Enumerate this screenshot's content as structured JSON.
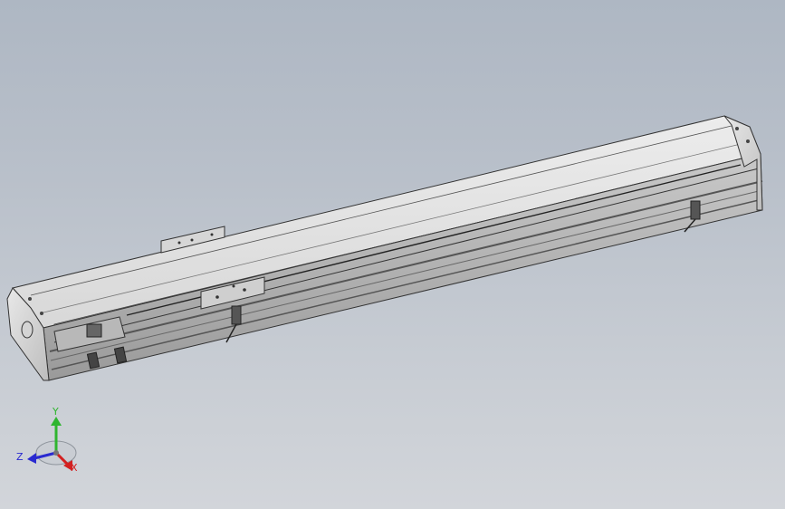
{
  "viewport": {
    "background_top": "#aeb7c3",
    "background_bottom": "#d2d5da"
  },
  "model": {
    "part": "linear-actuator-module",
    "body_color": "#e3e3e3",
    "edge_color": "#333333",
    "slot_color": "#555555"
  },
  "triad": {
    "x_label": "X",
    "y_label": "Y",
    "z_label": "Z",
    "x_color": "#d32020",
    "y_color": "#2fb52f",
    "z_color": "#2a2ad0"
  }
}
